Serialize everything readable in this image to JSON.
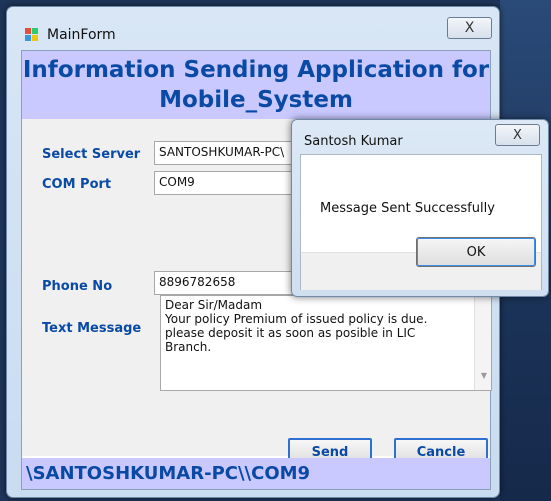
{
  "main_window": {
    "title": "MainForm",
    "close_glyph": "X",
    "header_line1": "Information Sending Application for",
    "header_line2": "Mobile_System",
    "form": {
      "select_server_label": "Select Server",
      "select_server_value": "SANTOSHKUMAR-PC\\",
      "com_port_label": "COM Port",
      "com_port_value": "COM9",
      "phone_label": "Phone No",
      "phone_value": "8896782658",
      "text_message_label": "Text Message",
      "text_message_lines": [
        "Dear Sir/Madam",
        "Your policy Premium of issued policy is due.",
        "please deposit it as soon as posible in LIC",
        "Branch."
      ]
    },
    "buttons": {
      "send": "Send",
      "cancle": "Cancle"
    },
    "status_text": "\\SANTOSHKUMAR-PC\\\\COM9"
  },
  "message_box": {
    "title": "Santosh Kumar",
    "close_glyph": "X",
    "message": "Message Sent Successfully",
    "ok_label": "OK"
  },
  "icons": {
    "app_icon": "windows-form-icon",
    "close": "close-icon"
  },
  "colors": {
    "accent_text": "#0a4aa5",
    "banner_bg": "#c9c9ff",
    "button_border": "#2f6fcf"
  }
}
